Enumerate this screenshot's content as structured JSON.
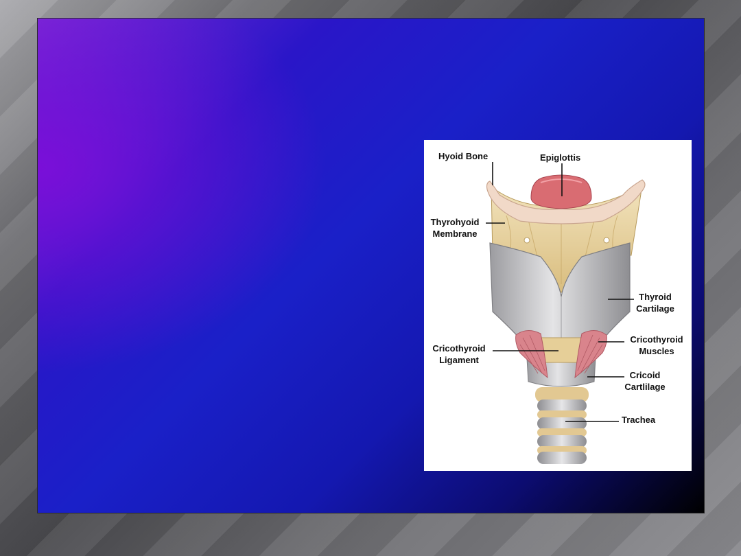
{
  "diagram": {
    "labels": {
      "hyoid_bone": "Hyoid Bone",
      "epiglottis": "Epiglottis",
      "thyrohyoid_line1": "Thyrohyoid",
      "thyrohyoid_line2": "Membrane",
      "thyroid_line1": "Thyroid",
      "thyroid_line2": "Cartilage",
      "cricothyroid_lig_line1": "Cricothyroid",
      "cricothyroid_lig_line2": "Ligament",
      "cricothyroid_mus_line1": "Cricothyroid",
      "cricothyroid_mus_line2": "Muscles",
      "cricoid_line1": "Cricoid",
      "cricoid_line2": "Cartlilage",
      "trachea": "Trachea"
    },
    "colors": {
      "cartilage": "#c9c9cc",
      "membrane": "#e8d3a0",
      "bone": "#f1d9c8",
      "muscle": "#d9848c",
      "epiglottis": "#d96c72"
    }
  }
}
